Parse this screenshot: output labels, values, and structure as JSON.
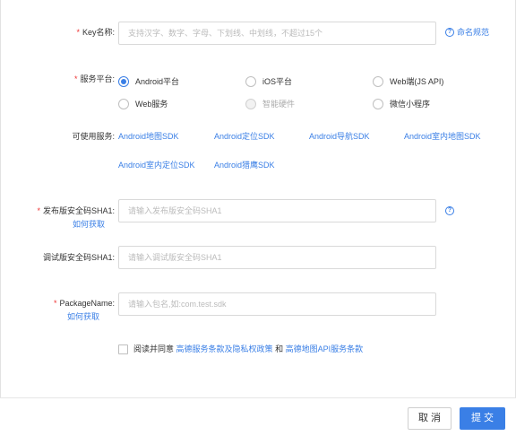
{
  "key_name": {
    "label": "Key名称:",
    "required_mark": "*",
    "placeholder": "支持汉字、数字、字母、下划线、中划线，不超过15个",
    "rule_link": "命名规范"
  },
  "platform": {
    "label": "服务平台:",
    "required_mark": "*",
    "options": [
      {
        "label": "Android平台",
        "checked": true,
        "disabled": false
      },
      {
        "label": "iOS平台",
        "checked": false,
        "disabled": false
      },
      {
        "label": "Web端(JS API)",
        "checked": false,
        "disabled": false
      },
      {
        "label": "Web服务",
        "checked": false,
        "disabled": false
      },
      {
        "label": "智能硬件",
        "checked": false,
        "disabled": true
      },
      {
        "label": "微信小程序",
        "checked": false,
        "disabled": false
      }
    ]
  },
  "services": {
    "label": "可使用服务:",
    "items": [
      "Android地图SDK",
      "Android定位SDK",
      "Android导航SDK",
      "Android室内地图SDK",
      "Android室内定位SDK",
      "Android猎鹰SDK"
    ]
  },
  "release_sha1": {
    "label": "发布版安全码SHA1:",
    "required_mark": "*",
    "how_link": "如何获取",
    "placeholder": "请输入发布版安全码SHA1"
  },
  "debug_sha1": {
    "label": "调试版安全码SHA1:",
    "placeholder": "请输入调试版安全码SHA1"
  },
  "package": {
    "label": "PackageName:",
    "required_mark": "*",
    "how_link": "如何获取",
    "placeholder": "请输入包名,如:com.test.sdk"
  },
  "agreement": {
    "prefix": "阅读并同意",
    "link1": "高德服务条款及隐私权政策",
    "conjunction": "和",
    "link2": "高德地图API服务条款"
  },
  "footer": {
    "cancel_label": "取 消",
    "submit_label": "提 交"
  },
  "colors": {
    "accent": "#3a7fe6",
    "required": "#e33333"
  }
}
